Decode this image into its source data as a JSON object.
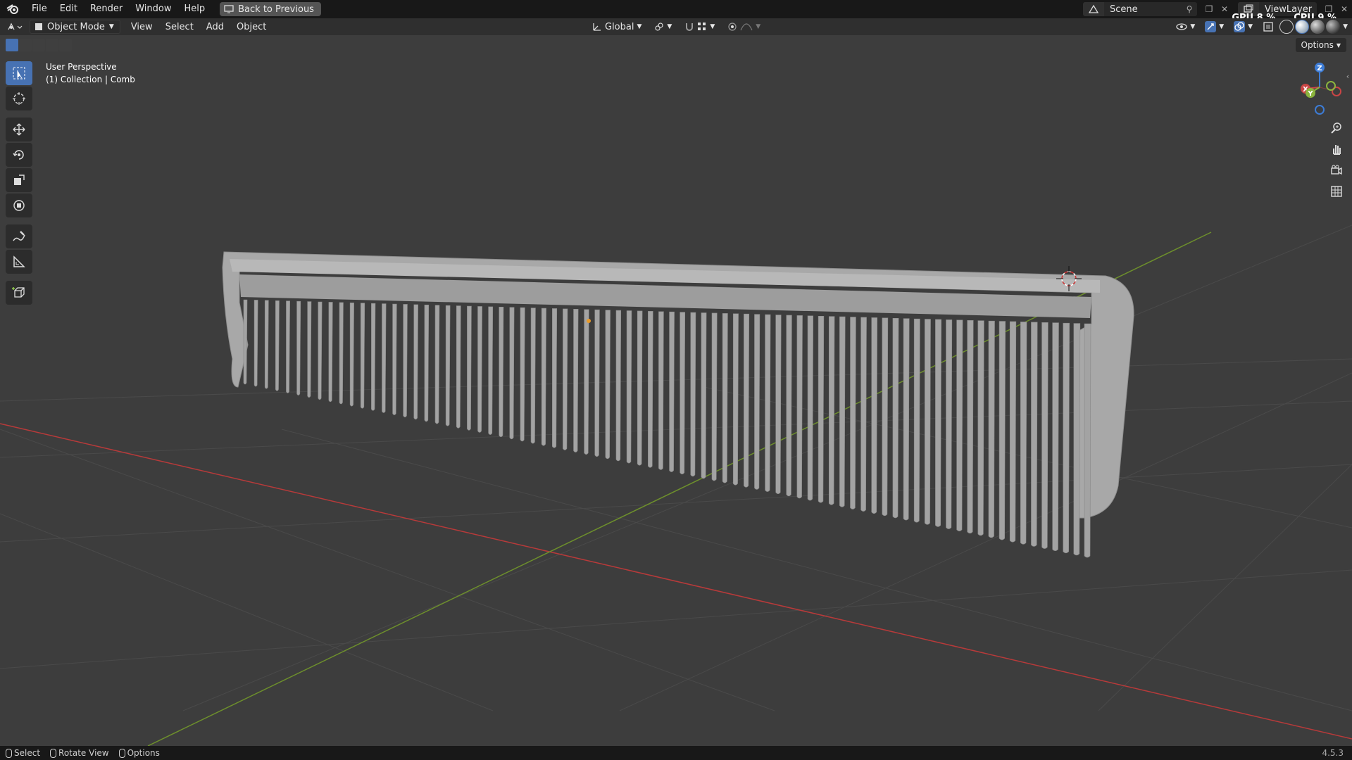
{
  "topbar": {
    "menus": [
      "File",
      "Edit",
      "Render",
      "Window",
      "Help"
    ],
    "back_button": "Back to Previous",
    "scene_name": "Scene",
    "view_layer_name": "ViewLayer",
    "gpu_label": "GPU",
    "gpu_value": "8 %",
    "cpu_label": "CPU",
    "cpu_value": "9 %"
  },
  "header": {
    "mode": "Object Mode",
    "menus": [
      "View",
      "Select",
      "Add",
      "Object"
    ],
    "transform_orientation": "Global"
  },
  "viewport": {
    "perspective_label": "User Perspective",
    "collection_label": "(1) Collection | Comb",
    "options_label": "Options",
    "gizmo_axes": [
      "X",
      "Y",
      "Z"
    ]
  },
  "statusbar": {
    "items": [
      "Select",
      "Rotate View",
      "Options"
    ],
    "version": "4.5.3"
  },
  "colors": {
    "accent": "#4772b3",
    "x_axis": "#c94545",
    "y_axis": "#8bb43e",
    "z_axis": "#3d7cd6",
    "comb": "#a9a9a9"
  }
}
